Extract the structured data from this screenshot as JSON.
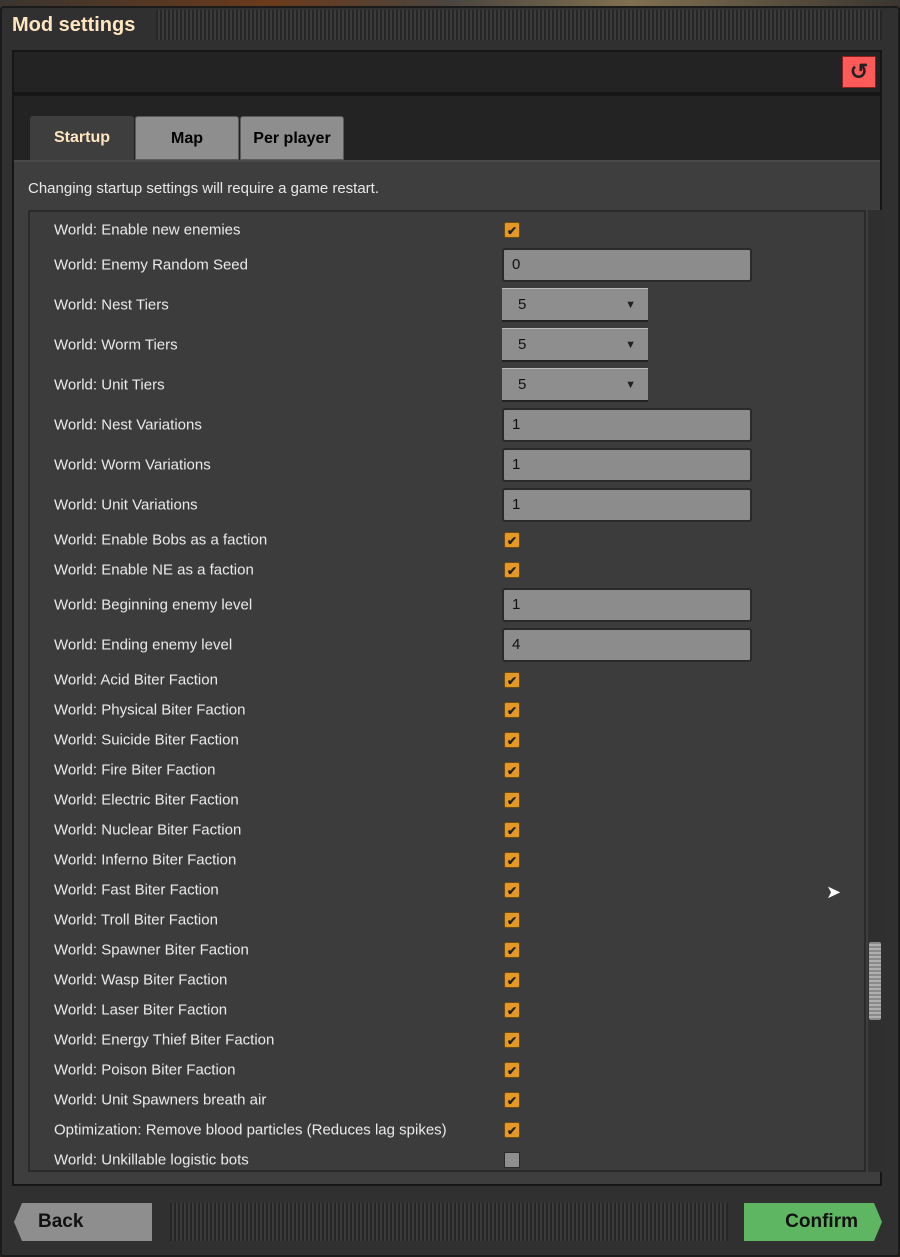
{
  "window": {
    "title": "Mod settings",
    "reset_icon": "reset-icon"
  },
  "tabs": [
    {
      "label": "Startup",
      "active": true
    },
    {
      "label": "Map",
      "active": false
    },
    {
      "label": "Per player",
      "active": false
    }
  ],
  "note": "Changing startup settings will require a game restart.",
  "settings": [
    {
      "label": "World: Enable new enemies",
      "type": "checkbox",
      "checked": true
    },
    {
      "label": "World: Enemy Random Seed",
      "type": "text",
      "value": "0"
    },
    {
      "label": "World: Nest Tiers",
      "type": "dropdown",
      "value": "5"
    },
    {
      "label": "World: Worm Tiers",
      "type": "dropdown",
      "value": "5"
    },
    {
      "label": "World: Unit Tiers",
      "type": "dropdown",
      "value": "5"
    },
    {
      "label": "World: Nest Variations",
      "type": "text",
      "value": "1"
    },
    {
      "label": "World: Worm Variations",
      "type": "text",
      "value": "1"
    },
    {
      "label": "World: Unit Variations",
      "type": "text",
      "value": "1"
    },
    {
      "label": "World: Enable Bobs as a faction",
      "type": "checkbox",
      "checked": true
    },
    {
      "label": "World: Enable NE as a faction",
      "type": "checkbox",
      "checked": true
    },
    {
      "label": "World: Beginning enemy level",
      "type": "text",
      "value": "1"
    },
    {
      "label": "World: Ending enemy level",
      "type": "text",
      "value": "4"
    },
    {
      "label": "World: Acid Biter Faction",
      "type": "checkbox",
      "checked": true
    },
    {
      "label": "World: Physical Biter Faction",
      "type": "checkbox",
      "checked": true
    },
    {
      "label": "World: Suicide Biter Faction",
      "type": "checkbox",
      "checked": true
    },
    {
      "label": "World: Fire Biter Faction",
      "type": "checkbox",
      "checked": true
    },
    {
      "label": "World: Electric Biter Faction",
      "type": "checkbox",
      "checked": true
    },
    {
      "label": "World: Nuclear Biter Faction",
      "type": "checkbox",
      "checked": true
    },
    {
      "label": "World: Inferno Biter Faction",
      "type": "checkbox",
      "checked": true
    },
    {
      "label": "World: Fast Biter Faction",
      "type": "checkbox",
      "checked": true
    },
    {
      "label": "World: Troll Biter Faction",
      "type": "checkbox",
      "checked": true
    },
    {
      "label": "World: Spawner Biter Faction",
      "type": "checkbox",
      "checked": true
    },
    {
      "label": "World: Wasp Biter Faction",
      "type": "checkbox",
      "checked": true
    },
    {
      "label": "World: Laser Biter Faction",
      "type": "checkbox",
      "checked": true
    },
    {
      "label": "World: Energy Thief Biter Faction",
      "type": "checkbox",
      "checked": true
    },
    {
      "label": "World: Poison Biter Faction",
      "type": "checkbox",
      "checked": true
    },
    {
      "label": "World: Unit Spawners breath air",
      "type": "checkbox",
      "checked": true
    },
    {
      "label": "Optimization: Remove blood particles (Reduces lag spikes)",
      "type": "checkbox",
      "checked": true
    },
    {
      "label": "World: Unkillable logistic bots",
      "type": "checkbox",
      "checked": false
    }
  ],
  "footer": {
    "back": "Back",
    "confirm": "Confirm"
  },
  "colors": {
    "accent": "#e39827",
    "confirm": "#5eb663",
    "reset": "#ff5a5a",
    "title": "#ffe6c0"
  }
}
